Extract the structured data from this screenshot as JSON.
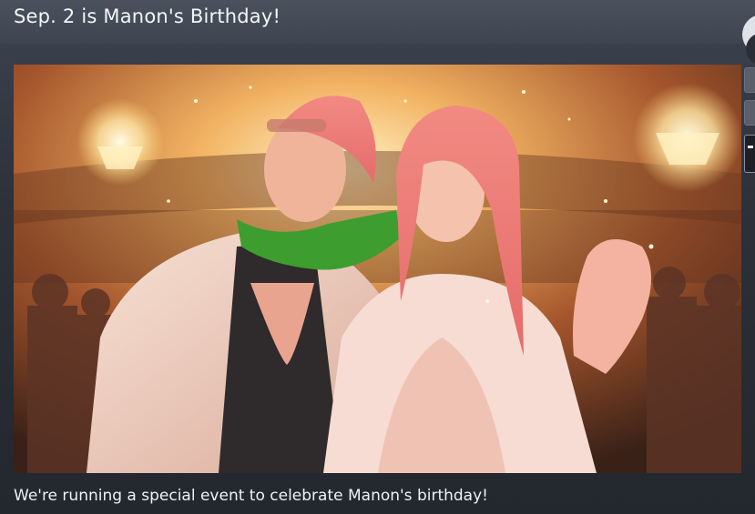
{
  "event": {
    "title": "Sep. 2 is Manon's Birthday!",
    "description": "We're running a special event to celebrate Manon's birthday!"
  },
  "hero_image": {
    "subject": "artwork-manon-birthday-party"
  },
  "side_controls": {
    "icons": [
      "scroll-circle-icon",
      "side-button",
      "side-button",
      "side-button-active"
    ]
  },
  "colors": {
    "background": "#2c313a",
    "header": "#4a515d",
    "text": "#f2f4f7"
  }
}
